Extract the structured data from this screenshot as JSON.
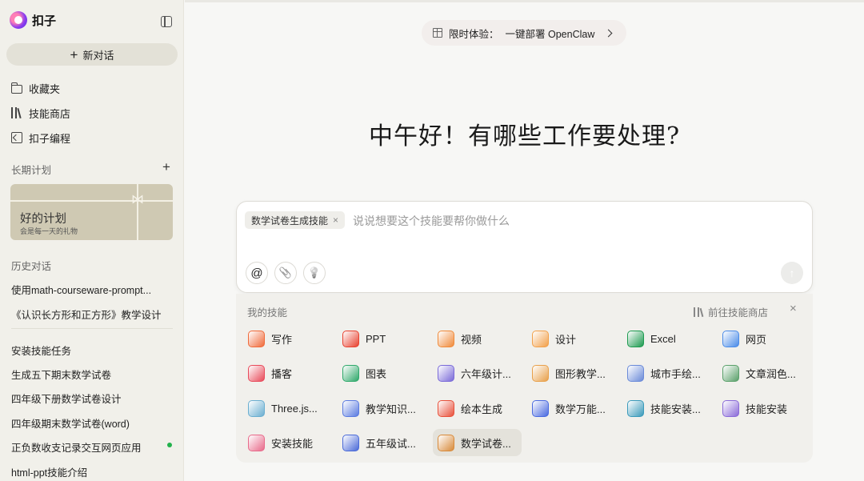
{
  "app": {
    "name": "扣子"
  },
  "sidebar": {
    "new_chat": "新对话",
    "nav": [
      {
        "label": "收藏夹",
        "icon": "folder-icon"
      },
      {
        "label": "技能商店",
        "icon": "books-icon"
      },
      {
        "label": "扣子编程",
        "icon": "code-icon"
      }
    ],
    "long_term_label": "长期计划",
    "plan_card": {
      "title": "好的计划",
      "subtitle": "会是每一天的礼物"
    },
    "history_label": "历史对话",
    "history": [
      "使用math-courseware-prompt...",
      "《认识长方形和正方形》教学设计",
      "安装技能任务",
      "生成五下期末数学试卷",
      "四年级下册数学试卷设计",
      "四年级期末数学试卷(word)",
      "正负数收支记录交互网页应用",
      "html-ppt技能介绍"
    ]
  },
  "banner": {
    "prefix": "限时体验：",
    "text": "一键部署 OpenClaw"
  },
  "greeting": "中午好！有哪些工作要处理?",
  "composer": {
    "chip": "数学试卷生成技能",
    "chip_close": "×",
    "placeholder": "说说想要这个技能要帮你做什么",
    "tools": {
      "mention": "@",
      "attach": "📎",
      "idea": "💡"
    },
    "send": "↑"
  },
  "skills_panel": {
    "title": "我的技能",
    "store_link": "前往技能商店",
    "close": "×",
    "skills": [
      {
        "label": "写作",
        "color": "#f06a3a"
      },
      {
        "label": "PPT",
        "color": "#e8412f"
      },
      {
        "label": "视频",
        "color": "#f08a3a"
      },
      {
        "label": "设计",
        "color": "#f2a04a"
      },
      {
        "label": "Excel",
        "color": "#1d9a4f"
      },
      {
        "label": "网页",
        "color": "#4a8be8"
      },
      {
        "label": "播客",
        "color": "#e84a5a"
      },
      {
        "label": "图表",
        "color": "#2ea86a"
      },
      {
        "label": "六年级计...",
        "color": "#7a6ad8"
      },
      {
        "label": "图形教学...",
        "color": "#e8a04a"
      },
      {
        "label": "城市手绘...",
        "color": "#6a8ad8"
      },
      {
        "label": "文章润色...",
        "color": "#5aa06a"
      },
      {
        "label": "Three.js...",
        "color": "#6aaed0"
      },
      {
        "label": "教学知识...",
        "color": "#5a7ae0"
      },
      {
        "label": "绘本生成",
        "color": "#e8503a"
      },
      {
        "label": "数学万能...",
        "color": "#4a6ae0"
      },
      {
        "label": "技能安装...",
        "color": "#3a9aba"
      },
      {
        "label": "技能安装",
        "color": "#8a6ad8"
      },
      {
        "label": "安装技能",
        "color": "#e86a8a"
      },
      {
        "label": "五年级试...",
        "color": "#4a6ad8"
      },
      {
        "label": "数学试卷...",
        "color": "#d88a3a"
      }
    ]
  }
}
